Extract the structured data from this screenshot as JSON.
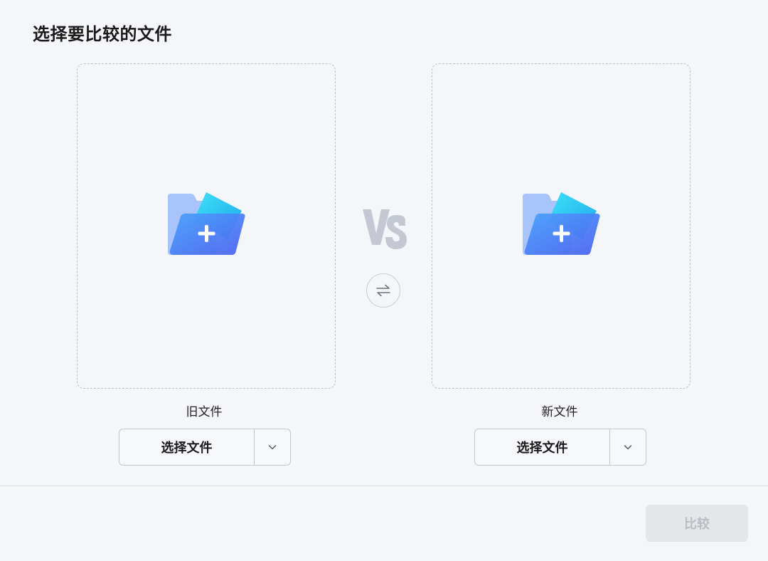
{
  "header": {
    "title": "选择要比较的文件"
  },
  "old_file": {
    "label": "旧文件",
    "select_button": "选择文件",
    "dropdown_icon": "chevron-down-icon",
    "drop_icon": "folder-add-icon"
  },
  "new_file": {
    "label": "新文件",
    "select_button": "选择文件",
    "dropdown_icon": "chevron-down-icon",
    "drop_icon": "folder-add-icon"
  },
  "middle": {
    "vs_text": "VS",
    "swap_icon": "swap-arrows-icon"
  },
  "footer": {
    "compare_button": "比较",
    "compare_enabled": false
  },
  "colors": {
    "background": "#f4f6fa",
    "folder_back": "#a9c4fb",
    "folder_front": "#4f7cf7",
    "folder_paper": "#22c8f0",
    "vs_text": "#c4c8d2",
    "disabled_button": "#e4e6ea"
  }
}
